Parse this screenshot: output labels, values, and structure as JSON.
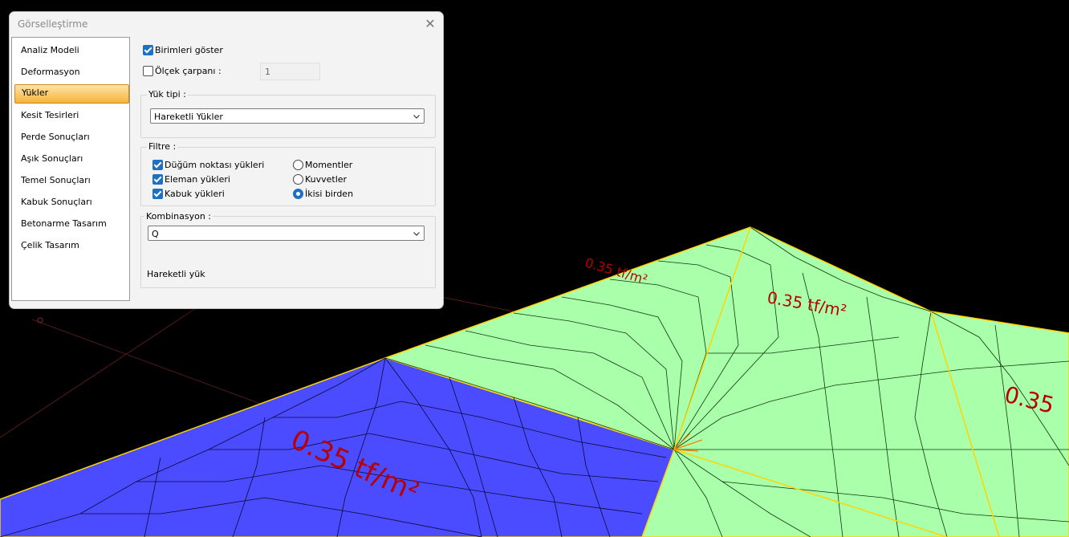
{
  "viewport": {
    "load_labels": [
      "0.35 tf/m²",
      "0.35 tf/m²",
      "0.35 tf/m²",
      "0.35"
    ],
    "colors": {
      "blue_region": "#4b4bff",
      "green_region": "#aaffaa",
      "edge": "#ffd400",
      "label": "#b80000"
    }
  },
  "dialog": {
    "title": "Görselleştirme",
    "close_icon": "close-icon",
    "nav": [
      {
        "label": "Analiz Modeli",
        "active": false
      },
      {
        "label": "Deformasyon",
        "active": false
      },
      {
        "label": "Yükler",
        "active": true
      },
      {
        "label": "Kesit Tesirleri",
        "active": false
      },
      {
        "label": "Perde Sonuçları",
        "active": false
      },
      {
        "label": "Aşık Sonuçları",
        "active": false
      },
      {
        "label": "Temel Sonuçları",
        "active": false
      },
      {
        "label": "Kabuk Sonuçları",
        "active": false
      },
      {
        "label": "Betonarme Tasarım",
        "active": false
      },
      {
        "label": "Çelik Tasarım",
        "active": false
      }
    ],
    "show_units": {
      "label": "Birimleri göster",
      "checked": true
    },
    "scale_factor": {
      "label": "Ölçek çarpanı :",
      "checked": false,
      "value": "1"
    },
    "load_type": {
      "title": "Yük tipi :",
      "selected": "Hareketli Yükler"
    },
    "filter": {
      "title": "Filtre :",
      "checks": [
        {
          "label": "Düğüm noktası yükleri",
          "checked": true
        },
        {
          "label": "Eleman yükleri",
          "checked": true
        },
        {
          "label": "Kabuk yükleri",
          "checked": true
        }
      ],
      "radios": [
        {
          "label": "Momentler",
          "selected": false
        },
        {
          "label": "Kuvvetler",
          "selected": false
        },
        {
          "label": "İkisi birden",
          "selected": true
        }
      ]
    },
    "combination": {
      "title": "Kombinasyon :",
      "selected": "Q",
      "description": "Hareketli yük"
    }
  }
}
